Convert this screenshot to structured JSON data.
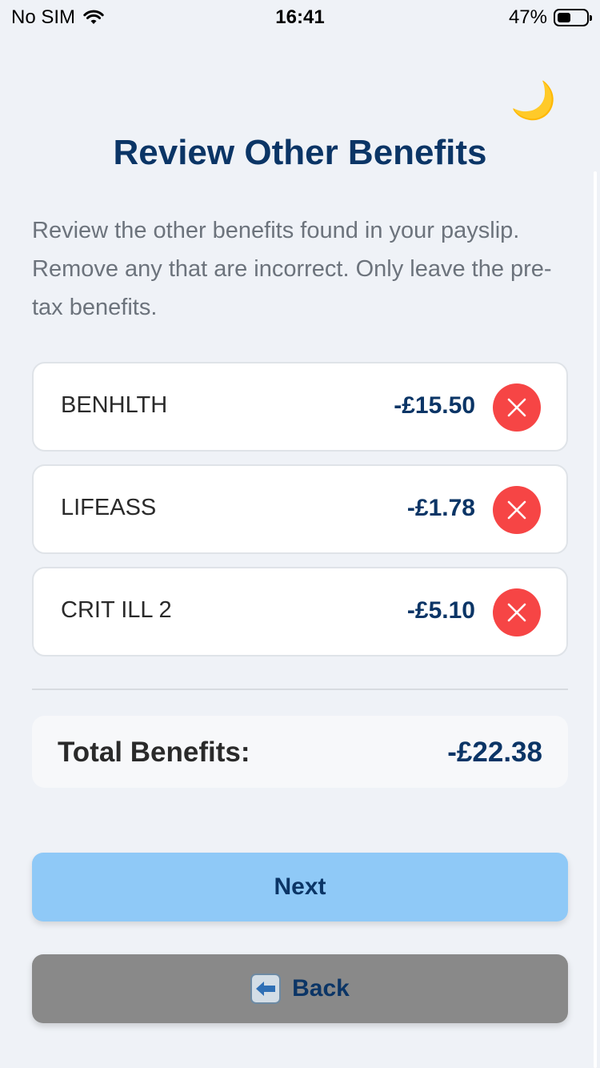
{
  "status_bar": {
    "carrier": "No SIM",
    "time": "16:41",
    "battery_percent": "47%",
    "battery_level": 0.47
  },
  "theme_toggle": {
    "icon": "moon-icon",
    "glyph": "🌙"
  },
  "title": "Review Other Benefits",
  "description": "Review the other benefits found in your payslip. Remove any that are incorrect. Only leave the pre-tax benefits.",
  "benefits": [
    {
      "name": "BENHLTH",
      "amount": "-£15.50"
    },
    {
      "name": "LIFEASS",
      "amount": "-£1.78"
    },
    {
      "name": "CRIT ILL 2",
      "amount": "-£5.10"
    }
  ],
  "total": {
    "label": "Total Benefits:",
    "value": "-£22.38"
  },
  "buttons": {
    "next": "Next",
    "back": "Back"
  },
  "colors": {
    "primary_text": "#0b3566",
    "remove": "#f64545",
    "next_bg": "#8fc9f7",
    "back_bg": "#898989",
    "background": "#eff2f7"
  }
}
